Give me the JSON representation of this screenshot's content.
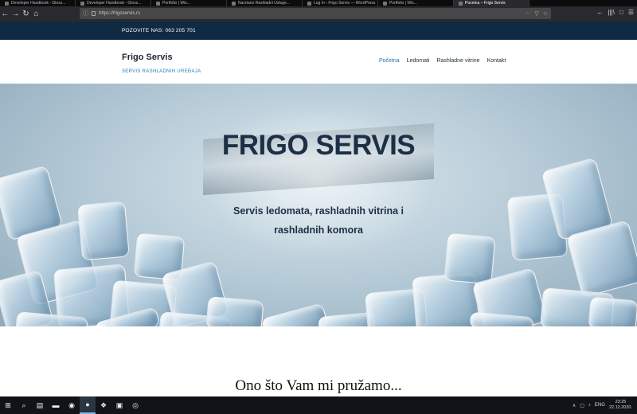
{
  "browser": {
    "tabs": [
      {
        "label": "Developer Handbook - Gloss..."
      },
      {
        "label": "Developer Handbook - Gloss..."
      },
      {
        "label": "Portfolio | Wix..."
      },
      {
        "label": "Nacrtano Rashladni Usluge..."
      },
      {
        "label": "Log In ‹ Frigo Servis — WordPress"
      },
      {
        "label": "Portfolio | Wix..."
      },
      {
        "label": "Pocetna – Frigo Servis",
        "active": true
      }
    ],
    "url": "https://frigoservis.rs",
    "nav_icons": [
      "back-icon",
      "forward-icon",
      "reload-icon",
      "home-icon"
    ],
    "nav_glyphs": [
      "←",
      "→",
      "↻",
      "⌂"
    ],
    "toolbar_right_glyphs": [
      "←",
      "|||\\",
      "□",
      "☰"
    ],
    "url_right_glyphs": [
      "···",
      "▽",
      "☆"
    ]
  },
  "topbar": {
    "phone": "POZOVITE NAS: 063 205 701"
  },
  "header": {
    "brand": "Frigo Servis",
    "tagline": "SERVIS RASHLADNIH UREĐAJA",
    "nav": [
      {
        "label": "Početna",
        "active": true
      },
      {
        "label": "Ledomati"
      },
      {
        "label": "Rashladne vitrine"
      },
      {
        "label": "Kontakt"
      }
    ]
  },
  "hero": {
    "title": "FRIGO SERVIS",
    "subtitle": "Servis ledomata, rashladnih vitrina i rashladnih komora"
  },
  "section": {
    "title": "Ono što Vam mi pružamo..."
  },
  "taskbar": {
    "apps": [
      {
        "icon": "windows-icon",
        "glyph": "⊞"
      },
      {
        "icon": "search-icon",
        "glyph": "⌕"
      },
      {
        "icon": "task-view-icon",
        "glyph": "▤"
      },
      {
        "icon": "file-explorer-icon",
        "glyph": "▬"
      },
      {
        "icon": "chrome-icon",
        "glyph": "◉"
      },
      {
        "icon": "firefox-icon",
        "glyph": "●",
        "active": true
      },
      {
        "icon": "vscode-icon",
        "glyph": "❖"
      },
      {
        "icon": "app-icon",
        "glyph": "▣"
      },
      {
        "icon": "app2-icon",
        "glyph": "◎"
      }
    ],
    "tray_glyphs": [
      "∧",
      "▢",
      "♪"
    ],
    "language": "ENG",
    "time": "23:25",
    "date": "22.12.2020."
  },
  "colors": {
    "topbar_bg": "#0f2a43",
    "accent": "#2a7fb8",
    "hero_text": "#1c2f45"
  }
}
